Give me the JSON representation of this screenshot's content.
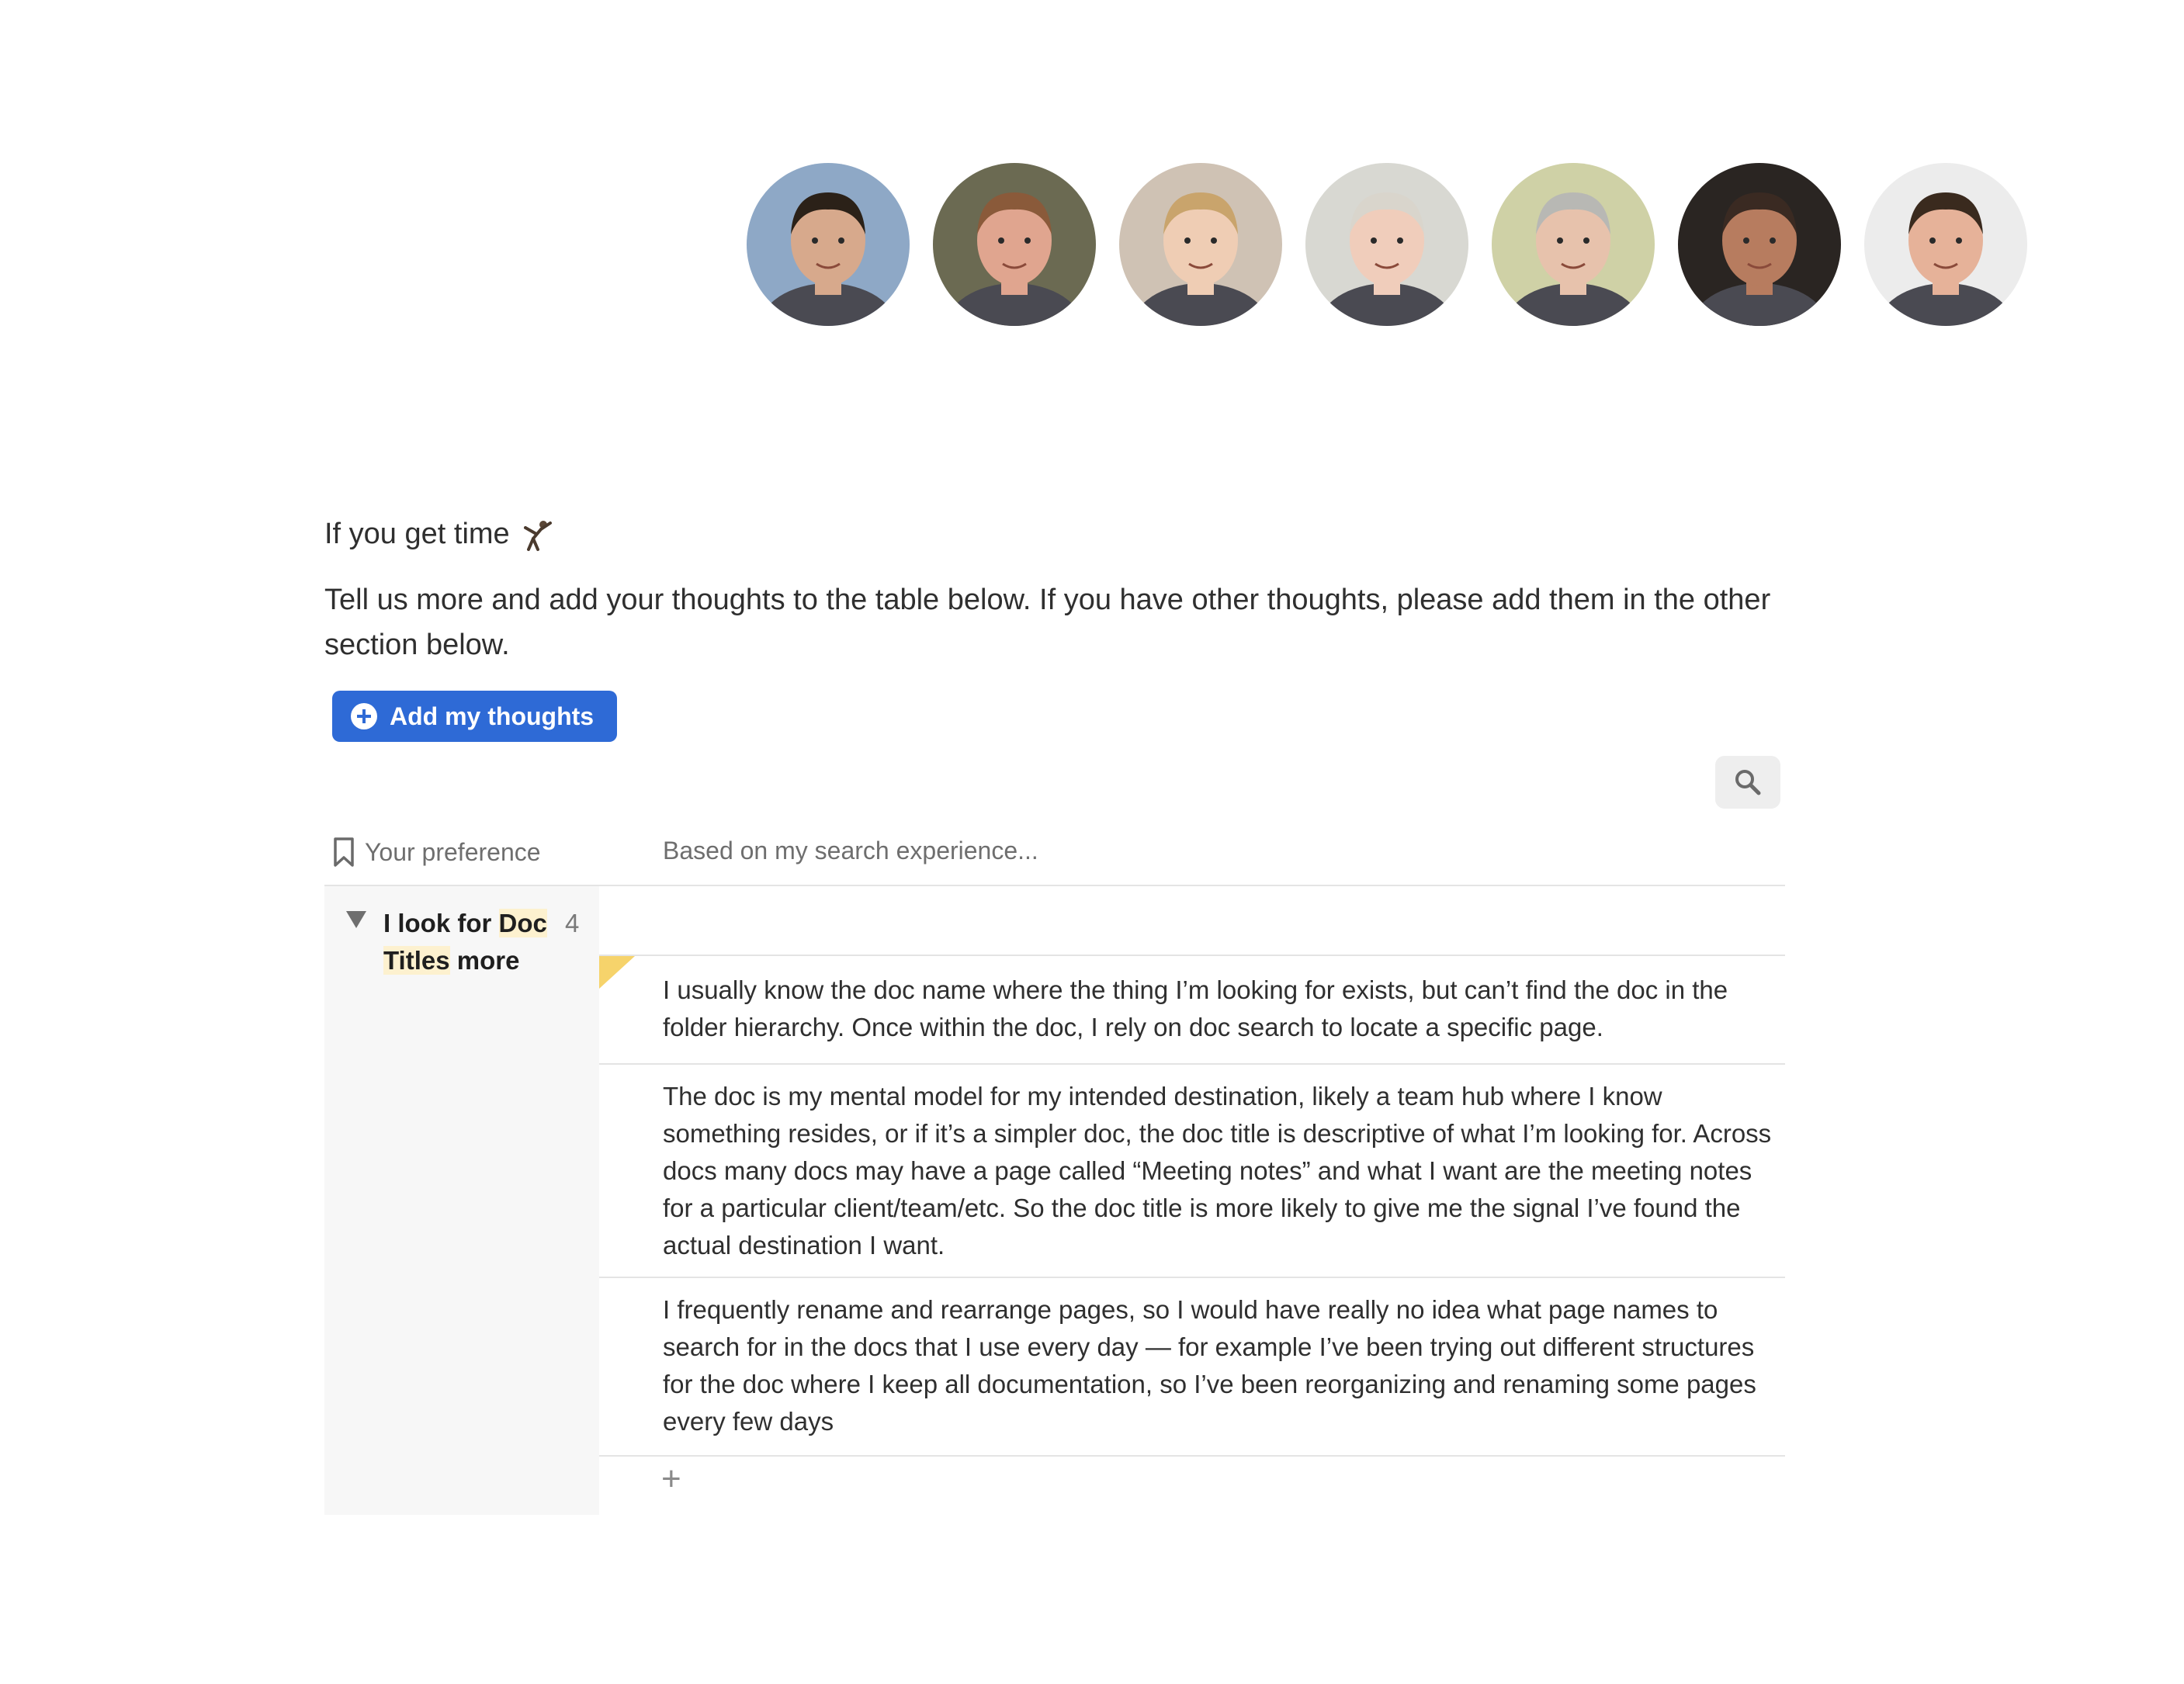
{
  "avatars": [
    {
      "name": "participant-1",
      "bg": "#8ea8c6",
      "skin": "#d7a98c",
      "hair": "#2b2118"
    },
    {
      "name": "participant-2",
      "bg": "#6b6a52",
      "skin": "#e0a58f",
      "hair": "#8a5a3a"
    },
    {
      "name": "participant-3",
      "bg": "#cfc2b4",
      "skin": "#efcdb4",
      "hair": "#c9a46c"
    },
    {
      "name": "participant-4",
      "bg": "#d8d8d2",
      "skin": "#f0cdbb",
      "hair": "#d9d5cc"
    },
    {
      "name": "participant-5",
      "bg": "#cfd1a6",
      "skin": "#e7c2ac",
      "hair": "#b8b8b4"
    },
    {
      "name": "participant-6",
      "bg": "#2a2522",
      "skin": "#b77c5f",
      "hair": "#3a2a22"
    },
    {
      "name": "participant-7",
      "bg": "#ececec",
      "skin": "#e6b299",
      "hair": "#3a2a1e"
    }
  ],
  "section": {
    "title": "If you get time",
    "title_icon": "cartwheel-emoji",
    "intro": "Tell us more and add your thoughts to the table below. If you have other thoughts, please add them in the other section below."
  },
  "actions": {
    "add_button_label": "Add my thoughts",
    "add_button_icon": "plus-circle-icon",
    "search_icon": "search-icon",
    "accent_color": "#2e6ad6"
  },
  "table": {
    "columns": [
      "Your preference",
      "Based on my search experience..."
    ],
    "group": {
      "title_parts": [
        "I look for ",
        "Doc",
        " ",
        "Titles",
        " more"
      ],
      "count": "4"
    },
    "rows": [
      "I usually know the doc name where the thing I’m looking for exists, but can’t find the doc in the folder hierarchy. Once within the doc, I rely on doc search to locate a specific page.",
      "The doc is my mental model for my intended destination, likely a team hub where I know something resides, or if it’s a simpler doc, the doc title is descriptive of what I’m looking for. Across docs many docs may have a page called “Meeting notes” and what I want are the meeting notes for a particular client/team/etc. So the doc title is more likely to give me the signal I’ve found the actual destination I want.",
      "I frequently rename and rearrange pages, so I would have really no idea what page names to search for in the docs that I use every day — for example I’ve been trying out different structures for the doc where I keep all documentation, so I’ve been reorganizing and renaming some pages every few days"
    ],
    "add_row_label": "+"
  }
}
